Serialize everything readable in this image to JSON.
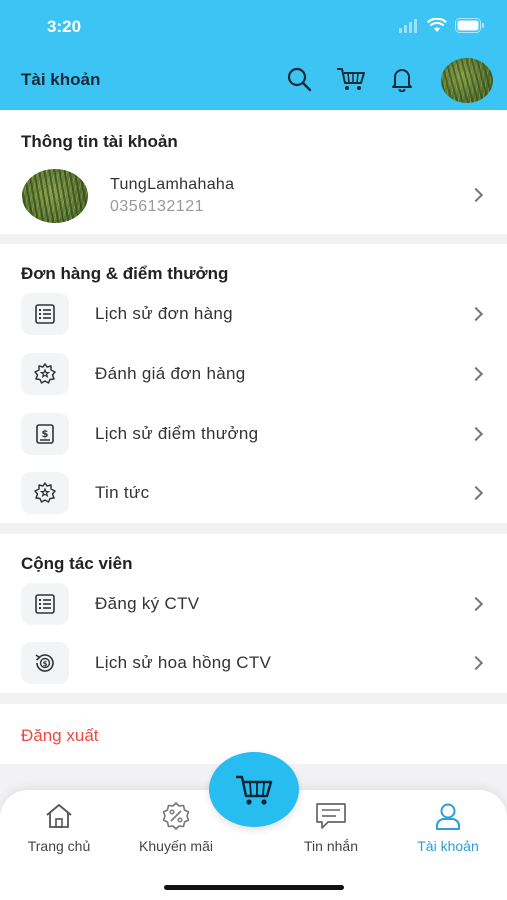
{
  "status_bar": {
    "time": "3:20"
  },
  "header": {
    "title": "Tài khoản"
  },
  "account": {
    "title": "Thông tin tài khoản",
    "username": "TungLamhahaha",
    "phone": "0356132121"
  },
  "orders": {
    "title": "Đơn hàng & điểm thưởng",
    "items": [
      {
        "label": "Lịch sử đơn hàng",
        "icon": "list-icon"
      },
      {
        "label": "Đánh giá đơn hàng",
        "icon": "badge-star-icon"
      },
      {
        "label": "Lịch sử điểm thưởng",
        "icon": "dollar-document-icon"
      },
      {
        "label": "Tin tức",
        "icon": "badge-star-icon"
      }
    ]
  },
  "collaborator": {
    "title": "Cộng tác viên",
    "items": [
      {
        "label": "Đăng ký CTV",
        "icon": "list-icon"
      },
      {
        "label": "Lịch sử hoa hồng CTV",
        "icon": "history-dollar-icon"
      }
    ]
  },
  "logout_label": "Đăng xuất",
  "tabbar": {
    "items": [
      {
        "label": "Trang chủ",
        "icon": "home-icon"
      },
      {
        "label": "Khuyến mãi",
        "icon": "discount-icon"
      },
      {
        "label": "Tin nhắn",
        "icon": "message-icon"
      },
      {
        "label": "Tài khoản",
        "icon": "user-icon",
        "active": true
      }
    ]
  },
  "colors": {
    "header": "#3cc4f5",
    "accent": "#27bdf0",
    "active_tab": "#2a9fd8",
    "logout": "#f0483e"
  }
}
